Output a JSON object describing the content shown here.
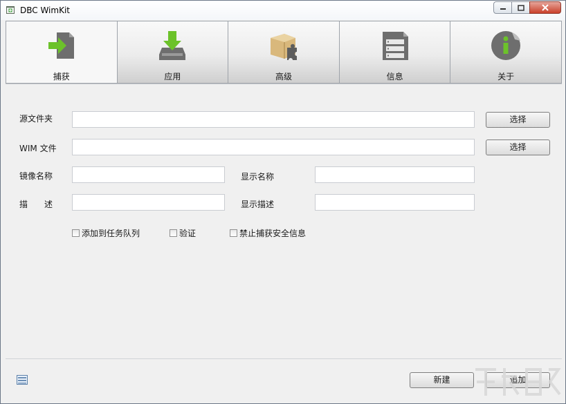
{
  "window": {
    "title": "DBC WimKit"
  },
  "tabs": [
    {
      "label": "捕获",
      "icon": "capture-arrow-icon",
      "active": true
    },
    {
      "label": "应用",
      "icon": "apply-download-icon",
      "active": false
    },
    {
      "label": "高级",
      "icon": "advanced-puzzle-box-icon",
      "active": false
    },
    {
      "label": "信息",
      "icon": "info-document-icon",
      "active": false
    },
    {
      "label": "关于",
      "icon": "about-info-icon",
      "active": false
    }
  ],
  "form": {
    "source_folder_label": "源文件夹",
    "source_folder_value": "",
    "wim_file_label": "WIM 文件",
    "wim_file_value": "",
    "browse_label": "选择",
    "image_name_label": "镜像名称",
    "image_name_value": "",
    "display_name_label": "显示名称",
    "display_name_value": "",
    "description_label": "描　　述",
    "description_value": "",
    "display_description_label": "显示描述",
    "display_description_value": ""
  },
  "options": {
    "add_to_queue": "添加到任务队列",
    "verify": "验证",
    "no_security_info": "禁止捕获安全信息"
  },
  "footer": {
    "new_label": "新建",
    "add_label": "追加"
  },
  "colors": {
    "accent_green": "#6cc22a",
    "icon_gray": "#6e6e6e",
    "tab_border": "#9ea3aa"
  }
}
